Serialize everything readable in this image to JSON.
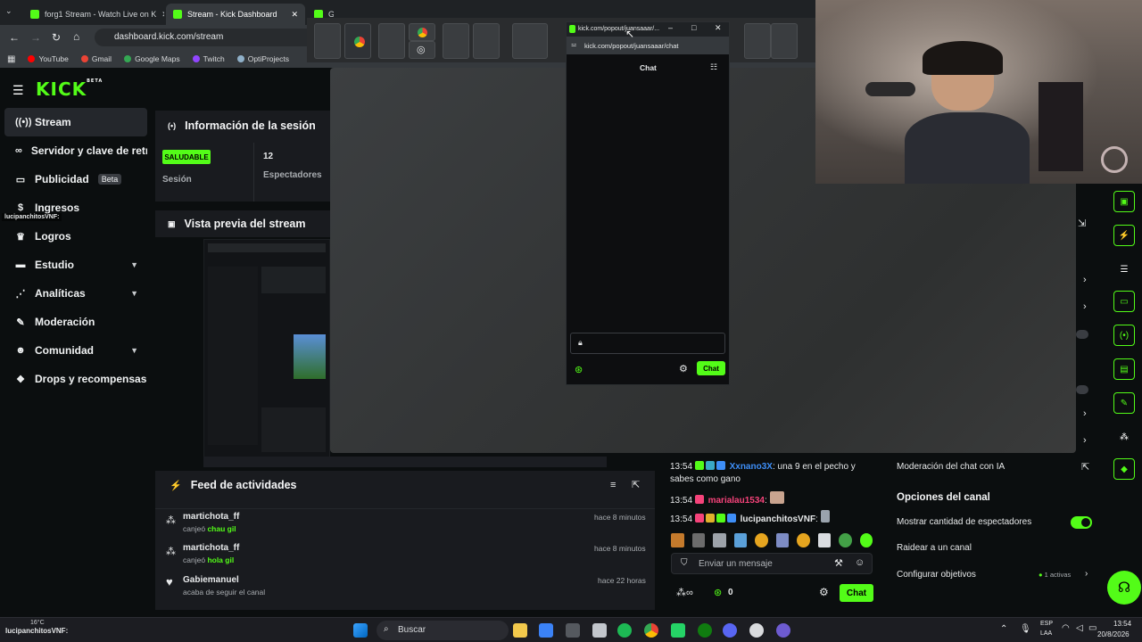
{
  "browser": {
    "tabs": [
      {
        "label": "forg1 Stream - Watch Live on K"
      },
      {
        "label": "Stream - Kick Dashboard"
      },
      {
        "label": "G"
      }
    ],
    "url": "dashboard.kick.com/stream",
    "bookmarks": [
      "YouTube",
      "Gmail",
      "Google Maps",
      "Twitch",
      "OptiProjects"
    ]
  },
  "brand": {
    "logo": "KICK",
    "logo_sup": "BETA"
  },
  "sidebar": {
    "items": [
      {
        "label": "Stream",
        "icon": "broadcast-icon"
      },
      {
        "label": "Servidor y clave de retrans",
        "icon": "link-icon"
      },
      {
        "label": "Publicidad",
        "icon": "ad-icon",
        "badge": "Beta"
      },
      {
        "label": "Ingresos",
        "icon": "money-icon"
      },
      {
        "label": "Logros",
        "icon": "trophy-icon"
      },
      {
        "label": "Estudio",
        "icon": "studio-icon"
      },
      {
        "label": "Analíticas",
        "icon": "chart-icon"
      },
      {
        "label": "Moderación",
        "icon": "hammer-icon"
      },
      {
        "label": "Comunidad",
        "icon": "community-icon"
      },
      {
        "label": "Drops y recompensas",
        "icon": "gift-icon"
      }
    ]
  },
  "session": {
    "title": "Información de la sesión",
    "status_badge": "SALUDABLE",
    "status_label": "Sesión",
    "viewers_value": "12",
    "viewers_label": "Espectadores"
  },
  "preview": {
    "title": "Vista previa del stream"
  },
  "feed": {
    "title": "Feed de actividades",
    "items": [
      {
        "user": "martichota_ff",
        "action": "canjeó",
        "reward": "chau gil",
        "time": "hace 8 minutos"
      },
      {
        "user": "martichota_ff",
        "action": "canjeó",
        "reward": "hola gil",
        "time": "hace 8 minutos"
      },
      {
        "user": "Gabiemanuel",
        "action": "acaba de seguir el canal",
        "reward": "",
        "time": "hace 22 horas"
      }
    ]
  },
  "popout": {
    "title": "kick.com/popout/juansaaar/...",
    "url": "kick.com/popout/juansaaar/chat",
    "chat_title": "Chat",
    "send_label": "Chat"
  },
  "chat": {
    "messages": [
      {
        "time": "13:54",
        "user": "Xxnano3X",
        "user_color": "#3e8ef7",
        "text": ": una 9 en el pecho y sabes como gano"
      },
      {
        "time": "13:54",
        "user": "marialau1534",
        "user_color": "#f5437a",
        "text": ":"
      },
      {
        "time": "13:54",
        "user": "lucipanchitosVNF",
        "user_color": "#e8e8e8",
        "text": ":"
      }
    ],
    "input_placeholder": "Enviar un mensaje",
    "points": "0",
    "send_label": "Chat"
  },
  "channel": {
    "ai_mod_label": "Moderación del chat con IA",
    "options_title": "Opciones del canal",
    "show_viewers_label": "Mostrar cantidad de espectadores",
    "show_viewers_on": true,
    "raid_label": "Raidear a un canal",
    "goals_label": "Configurar objetivos",
    "goals_count": "1 activas"
  },
  "overlay_user": "lucipanchitosVNF:",
  "taskbar": {
    "weather": "16°C",
    "notif_user": "lucipanchitosVNF:",
    "search_label": "Buscar",
    "lang_top": "ESP",
    "lang_bottom": "LAA",
    "clock_time": "13:54",
    "clock_date": "20/8/2026"
  },
  "colors": {
    "accent": "#53fc18",
    "bg": "#0b0e0f",
    "panel": "#191b1f"
  }
}
